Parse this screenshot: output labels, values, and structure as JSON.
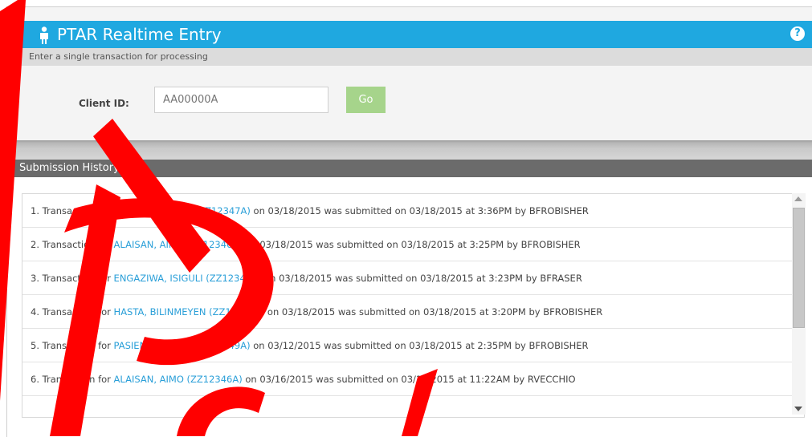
{
  "header": {
    "title": "PTAR Realtime Entry",
    "subtitle": "Enter a single transaction for processing",
    "help_icon": "?"
  },
  "client": {
    "label": "Client ID:",
    "placeholder": "AA00000A",
    "go_label": "Go"
  },
  "history": {
    "title": "Submission History",
    "items": [
      {
        "prefix": "1. Transaction for ",
        "link": "ANHYSBYS, CLAF (ZZ12347A)",
        "suffix": " on 03/18/2015 was submitted on 03/18/2015 at 3:36PM by BFROBISHER"
      },
      {
        "prefix": "2. Transaction for ",
        "link": "ALAISAN, AIMO (ZZ12346A)",
        "suffix": " on 03/18/2015 was submitted on 03/18/2015 at 3:25PM by BFROBISHER"
      },
      {
        "prefix": "3. Transaction for ",
        "link": "ENGAZIWA, ISIGULI (ZZ12345A)",
        "suffix": " on 03/18/2015 was submitted on 03/18/2015 at 3:23PM by BFRASER"
      },
      {
        "prefix": "4. Transaction for ",
        "link": "HASTA, BILINMEYEN (ZZ12348A)",
        "suffix": " on 03/18/2015 was submitted on 03/18/2015 at 3:20PM by BFROBISHER"
      },
      {
        "prefix": "5. Transaction for ",
        "link": "PASIENT, UKJENT (ZZ12349A)",
        "suffix": " on 03/12/2015 was submitted on 03/18/2015 at 2:35PM by BFROBISHER"
      },
      {
        "prefix": "6. Transaction for ",
        "link": "ALAISAN, AIMO (ZZ12346A)",
        "suffix": " on 03/16/2015 was submitted on 03/18/2015 at 11:22AM by RVECCHIO"
      }
    ]
  },
  "colors": {
    "accent": "#1fa8e0",
    "link": "#2a9fd8",
    "go_button": "#a6d48b",
    "watermark": "#ff0000"
  },
  "icons": {
    "title_icon": "person-icon",
    "help": "help-icon",
    "scroll_up": "scroll-up-arrow-icon",
    "scroll_down": "scroll-down-arrow-icon"
  }
}
